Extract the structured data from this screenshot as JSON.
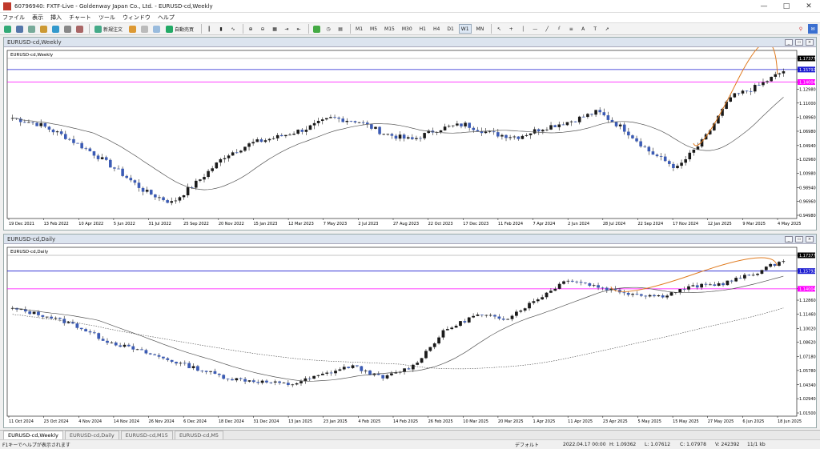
{
  "window": {
    "title": "60796940: FXTF-Live - Goldenway Japan Co., Ltd. - EURUSD-cd,Weekly"
  },
  "menu": [
    "ファイル",
    "表示",
    "挿入",
    "チャート",
    "ツール",
    "ウィンドウ",
    "ヘルプ"
  ],
  "toolbar": {
    "new_order": "新規注文",
    "auto_trade": "自動売買",
    "timeframes": [
      "M1",
      "M5",
      "M15",
      "M30",
      "H1",
      "H4",
      "D1",
      "W1",
      "MN"
    ],
    "active_timeframe": "W1"
  },
  "weekly_chart": {
    "window_title": "EURUSD-cd,Weekly",
    "label": "EURUSD-cd,Weekly",
    "price_labels": [
      "1.17377",
      "1.15792",
      "1.14004",
      "1.12980",
      "1.11000",
      "1.08960",
      "1.06980",
      "1.04940",
      "1.02960",
      "1.00980",
      "0.98940",
      "0.96960",
      "0.94980"
    ],
    "date_labels": [
      "19 Dec 2021",
      "13 Feb 2022",
      "10 Apr 2022",
      "5 Jun 2022",
      "31 Jul 2022",
      "25 Sep 2022",
      "20 Nov 2022",
      "15 Jan 2023",
      "12 Mar 2023",
      "7 May 2023",
      "2 Jul 2023",
      "27 Aug 2023",
      "22 Oct 2023",
      "17 Dec 2023",
      "11 Feb 2024",
      "7 Apr 2024",
      "2 Jun 2024",
      "28 Jul 2024",
      "22 Sep 2024",
      "17 Nov 2024",
      "12 Jan 2025",
      "9 Mar 2025",
      "4 May 2025"
    ]
  },
  "daily_chart": {
    "window_title": "EURUSD-cd,Daily",
    "label": "EURUSD-cd,Daily",
    "price_labels": [
      "1.17377",
      "1.15792",
      "1.14004",
      "1.12860",
      "1.11460",
      "1.10020",
      "1.08620",
      "1.07180",
      "1.05780",
      "1.04340",
      "1.02940",
      "1.01500"
    ],
    "date_labels": [
      "11 Oct 2024",
      "23 Oct 2024",
      "4 Nov 2024",
      "14 Nov 2024",
      "26 Nov 2024",
      "6 Dec 2024",
      "18 Dec 2024",
      "31 Dec 2024",
      "13 Jan 2025",
      "23 Jan 2025",
      "4 Feb 2025",
      "14 Feb 2025",
      "26 Feb 2025",
      "10 Mar 2025",
      "20 Mar 2025",
      "1 Apr 2025",
      "11 Apr 2025",
      "23 Apr 2025",
      "5 May 2025",
      "15 May 2025",
      "27 May 2025",
      "6 Jun 2025",
      "18 Jun 2025"
    ]
  },
  "tabs": [
    "EURUSD-cd,Weekly",
    "EURUSD-cd,Daily",
    "EURUSD-cd,M15",
    "EURUSD-cd,M5"
  ],
  "active_tab": "EURUSD-cd,Weekly",
  "status": {
    "help": "F1キーでヘルプが表示されます",
    "profile": "デフォルト",
    "datetime": "2022.04.17 00:00",
    "high": "H: 1.09362",
    "low": "L: 1.07612",
    "close": "C: 1.07978",
    "volume": "V: 242392",
    "traffic": "11/1 kb"
  },
  "colors": {
    "bull": "#1a1a1a",
    "bear": "#3b5bb5",
    "wick": "#222222",
    "ma": "#555555",
    "magenta_line": "#ff00ff",
    "blue_line": "#1a1ad0",
    "orange_stroke": "#e07b20",
    "last_price_bg": "#000000"
  }
}
